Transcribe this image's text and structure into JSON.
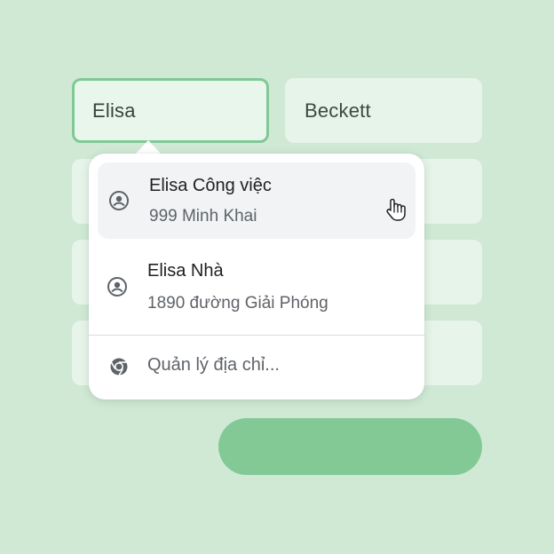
{
  "form": {
    "first_name_value": "Elisa",
    "last_name_value": "Beckett"
  },
  "autofill": {
    "items": [
      {
        "title": "Elisa Công việc",
        "subtitle": "999 Minh Khai",
        "icon": "account-circle-icon"
      },
      {
        "title": "Elisa Nhà",
        "subtitle": "1890 đường Giải Phóng",
        "icon": "account-circle-icon"
      }
    ],
    "manage_label": "Quản lý địa chỉ...",
    "manage_icon": "chrome-icon"
  },
  "colors": {
    "background": "#cfe9d5",
    "field": "#e6f4e9",
    "focus_border": "#7fc996",
    "submit_button": "#82c996",
    "highlight": "#f1f3f4"
  }
}
